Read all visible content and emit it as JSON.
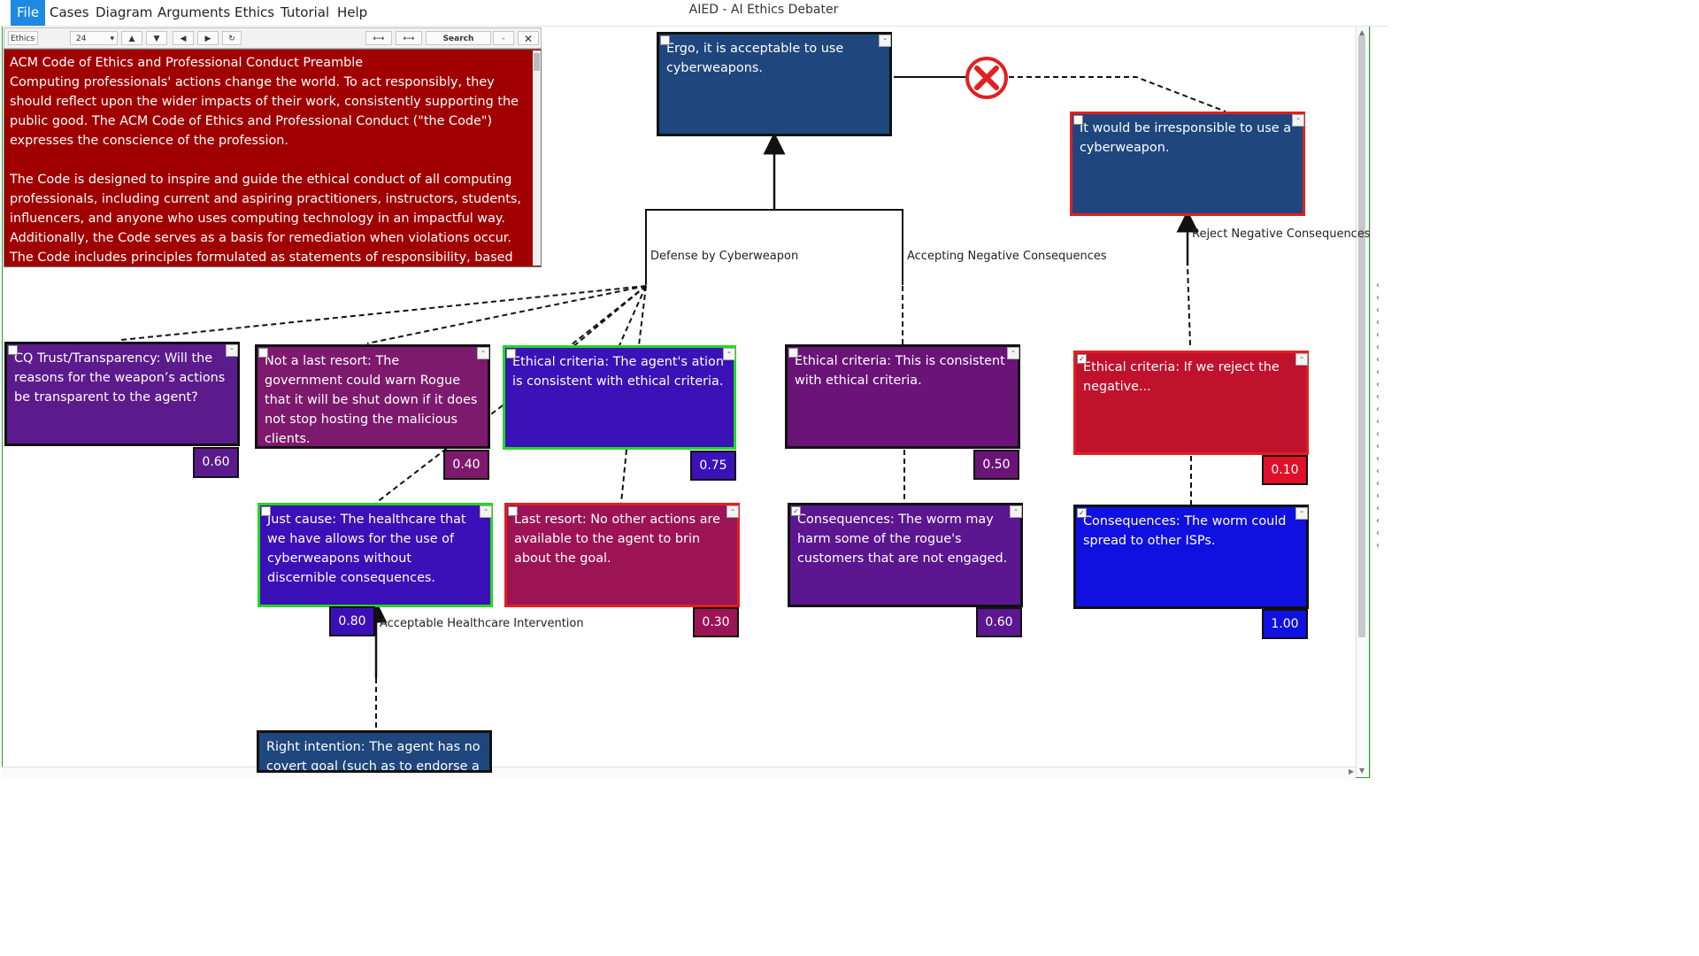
{
  "window": {
    "title": "AIED - AI Ethics Debater"
  },
  "menu": [
    "File",
    "Cases",
    "Diagram",
    "Arguments",
    "Ethics",
    "Tutorial",
    "Help"
  ],
  "doc_toolbar": {
    "source_label": "Ethics",
    "font_size": "24",
    "search_label": "Search",
    "minus_label": "-",
    "close_label": "✕"
  },
  "document": {
    "text": "ACM Code of Ethics and Professional Conduct Preamble\nComputing professionals' actions change the world. To act responsibly, they should reflect upon the wider impacts of their work, consistently supporting the public good. The ACM Code of Ethics and Professional Conduct (\"the Code\") expresses the conscience of the profession.\n\nThe Code is designed to inspire and guide the ethical conduct of all computing professionals, including current and aspiring practitioners, instructors, students, influencers, and anyone who uses computing technology in an impactful way. Additionally, the Code serves as a basis for remediation when violations occur. The Code includes principles formulated as statements of responsibility, based on the understanding that the"
  },
  "nodes": {
    "ergo": {
      "text": "Ergo, it is acceptable to use cyberweapons.",
      "color": "#1f477d"
    },
    "irresponsible": {
      "text": "It would be irresponsible to use a cyberweapon.",
      "color": "#1f477d"
    },
    "cq_trust": {
      "text": "CQ Trust/Transparency: Will the reasons for the weapon’s actions be transparent to the agent?",
      "score": "0.60",
      "color": "#5c1b8c"
    },
    "not_last_resort": {
      "text": "Not a last resort: The government could warn Rogue that it will be shut down if it does not stop hosting the malicious clients.",
      "score": "0.40",
      "color": "#7d1a6d"
    },
    "ethical_agent": {
      "text": "Ethical criteria: The agent's ation is consistent with ethical criteria.",
      "score": "0.75",
      "color": "#3a12b8"
    },
    "ethical_consistent": {
      "text": "Ethical criteria: This is consistent with ethical criteria.",
      "score": "0.50",
      "color": "#6a1478"
    },
    "ethical_reject": {
      "text": "Ethical criteria: If we reject the negative...",
      "score": "0.10",
      "color": "#c0112d"
    },
    "just_cause": {
      "text": "Just cause: The healthcare that we have allows for the use of cyberweapons without discernible consequences.",
      "score": "0.80",
      "color": "#3b10b8"
    },
    "last_resort": {
      "text": "Last resort: No other actions are available to the agent to brin about the goal.",
      "score": "0.30",
      "color": "#9c1455"
    },
    "worm_harm": {
      "text": "Consequences: The worm may harm some of the rogue's customers that are not engaged.",
      "score": "0.60",
      "color": "#5c1690"
    },
    "worm_spread": {
      "text": "Consequences: The worm could spread to other ISPs.",
      "score": "1.00",
      "color": "#1010e0"
    },
    "right_intention": {
      "text": "Right intention: The agent has no covert goal (such as to endorse a",
      "color": "#1f477d"
    }
  },
  "edge_labels": {
    "defense": "Defense by Cyberweapon",
    "accepting": "Accepting Negative Consequences",
    "reject": "Reject Negative Consequences",
    "healthcare": "Acceptable Healthcare Intervention"
  },
  "icons": {
    "conflict": "x-circle-icon",
    "collapse": "minus-box-icon",
    "checkbox": "checkbox-icon"
  }
}
